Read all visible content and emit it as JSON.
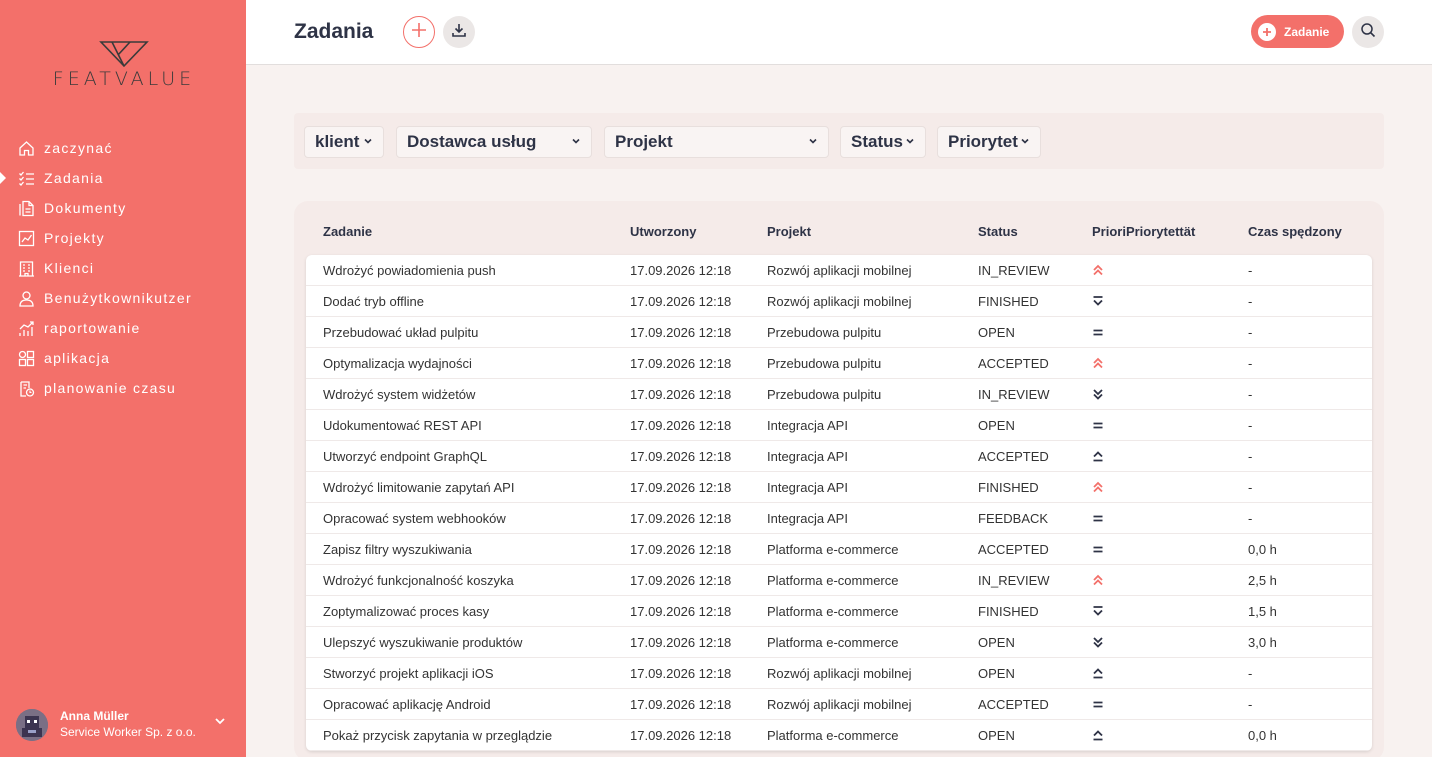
{
  "brand": {
    "name": "FEATVALUE"
  },
  "sidebar": {
    "items": [
      {
        "label": "zaczynać",
        "icon": "home-icon"
      },
      {
        "label": "Zadania",
        "icon": "task-list-icon",
        "active": true
      },
      {
        "label": "Dokumenty",
        "icon": "documents-icon"
      },
      {
        "label": "Projekty",
        "icon": "chart-icon"
      },
      {
        "label": "Klienci",
        "icon": "building-icon"
      },
      {
        "label": "Benużytkownikutzer",
        "icon": "user-icon"
      },
      {
        "label": "raportowanie",
        "icon": "report-icon"
      },
      {
        "label": "aplikacja",
        "icon": "apps-icon"
      },
      {
        "label": "planowanie czasu",
        "icon": "time-planning-icon"
      }
    ],
    "user": {
      "name": "Anna Müller",
      "company": "Service Worker Sp. z o.o."
    }
  },
  "header": {
    "title": "Zadania",
    "new_task_label": "Zadanie"
  },
  "filters": {
    "client": "klient",
    "provider": "Dostawca usług",
    "project": "Projekt",
    "status": "Status",
    "priority": "Priorytet"
  },
  "table": {
    "columns": {
      "task": "Zadanie",
      "created": "Utworzony",
      "project": "Projekt",
      "status": "Status",
      "priority": "PrioriPriorytettät",
      "time": "Czas spędzony"
    },
    "rows": [
      {
        "task": "Wdrożyć powiadomienia push",
        "created": "17.09.2026 12:18",
        "project": "Rozwój aplikacji mobilnej",
        "status": "IN_REVIEW",
        "priority": "highest",
        "time": "-"
      },
      {
        "task": "Dodać tryb offline",
        "created": "17.09.2026 12:18",
        "project": "Rozwój aplikacji mobilnej",
        "status": "FINISHED",
        "priority": "low",
        "time": "-"
      },
      {
        "task": "Przebudować układ pulpitu",
        "created": "17.09.2026 12:18",
        "project": "Przebudowa pulpitu",
        "status": "OPEN",
        "priority": "medium",
        "time": "-"
      },
      {
        "task": "Optymalizacja wydajności",
        "created": "17.09.2026 12:18",
        "project": "Przebudowa pulpitu",
        "status": "ACCEPTED",
        "priority": "highest",
        "time": "-"
      },
      {
        "task": "Wdrożyć system widżetów",
        "created": "17.09.2026 12:18",
        "project": "Przebudowa pulpitu",
        "status": "IN_REVIEW",
        "priority": "lowest",
        "time": "-"
      },
      {
        "task": "Udokumentować REST API",
        "created": "17.09.2026 12:18",
        "project": "Integracja API",
        "status": "OPEN",
        "priority": "medium",
        "time": "-"
      },
      {
        "task": "Utworzyć endpoint GraphQL",
        "created": "17.09.2026 12:18",
        "project": "Integracja API",
        "status": "ACCEPTED",
        "priority": "high",
        "time": "-"
      },
      {
        "task": "Wdrożyć limitowanie zapytań API",
        "created": "17.09.2026 12:18",
        "project": "Integracja API",
        "status": "FINISHED",
        "priority": "highest",
        "time": "-"
      },
      {
        "task": "Opracować system webhooków",
        "created": "17.09.2026 12:18",
        "project": "Integracja API",
        "status": "FEEDBACK",
        "priority": "medium",
        "time": "-"
      },
      {
        "task": "Zapisz filtry wyszukiwania",
        "created": "17.09.2026 12:18",
        "project": "Platforma e-commerce",
        "status": "ACCEPTED",
        "priority": "medium",
        "time": "0,0 h"
      },
      {
        "task": "Wdrożyć funkcjonalność koszyka",
        "created": "17.09.2026 12:18",
        "project": "Platforma e-commerce",
        "status": "IN_REVIEW",
        "priority": "highest",
        "time": "2,5 h"
      },
      {
        "task": "Zoptymalizować proces kasy",
        "created": "17.09.2026 12:18",
        "project": "Platforma e-commerce",
        "status": "FINISHED",
        "priority": "low",
        "time": "1,5 h"
      },
      {
        "task": "Ulepszyć wyszukiwanie produktów",
        "created": "17.09.2026 12:18",
        "project": "Platforma e-commerce",
        "status": "OPEN",
        "priority": "lowest",
        "time": "3,0 h"
      },
      {
        "task": "Stworzyć projekt aplikacji iOS",
        "created": "17.09.2026 12:18",
        "project": "Rozwój aplikacji mobilnej",
        "status": "OPEN",
        "priority": "high",
        "time": "-"
      },
      {
        "task": "Opracować aplikację Android",
        "created": "17.09.2026 12:18",
        "project": "Rozwój aplikacji mobilnej",
        "status": "ACCEPTED",
        "priority": "medium",
        "time": "-"
      },
      {
        "task": "Pokaż przycisk zapytania w przeglądzie",
        "created": "17.09.2026 12:18",
        "project": "Platforma e-commerce",
        "status": "OPEN",
        "priority": "high",
        "time": "0,0 h"
      }
    ]
  },
  "colors": {
    "accent": "#f3706a",
    "heading": "#2e3346",
    "priority_high": "#f3706a",
    "priority_normal": "#2e3346"
  }
}
